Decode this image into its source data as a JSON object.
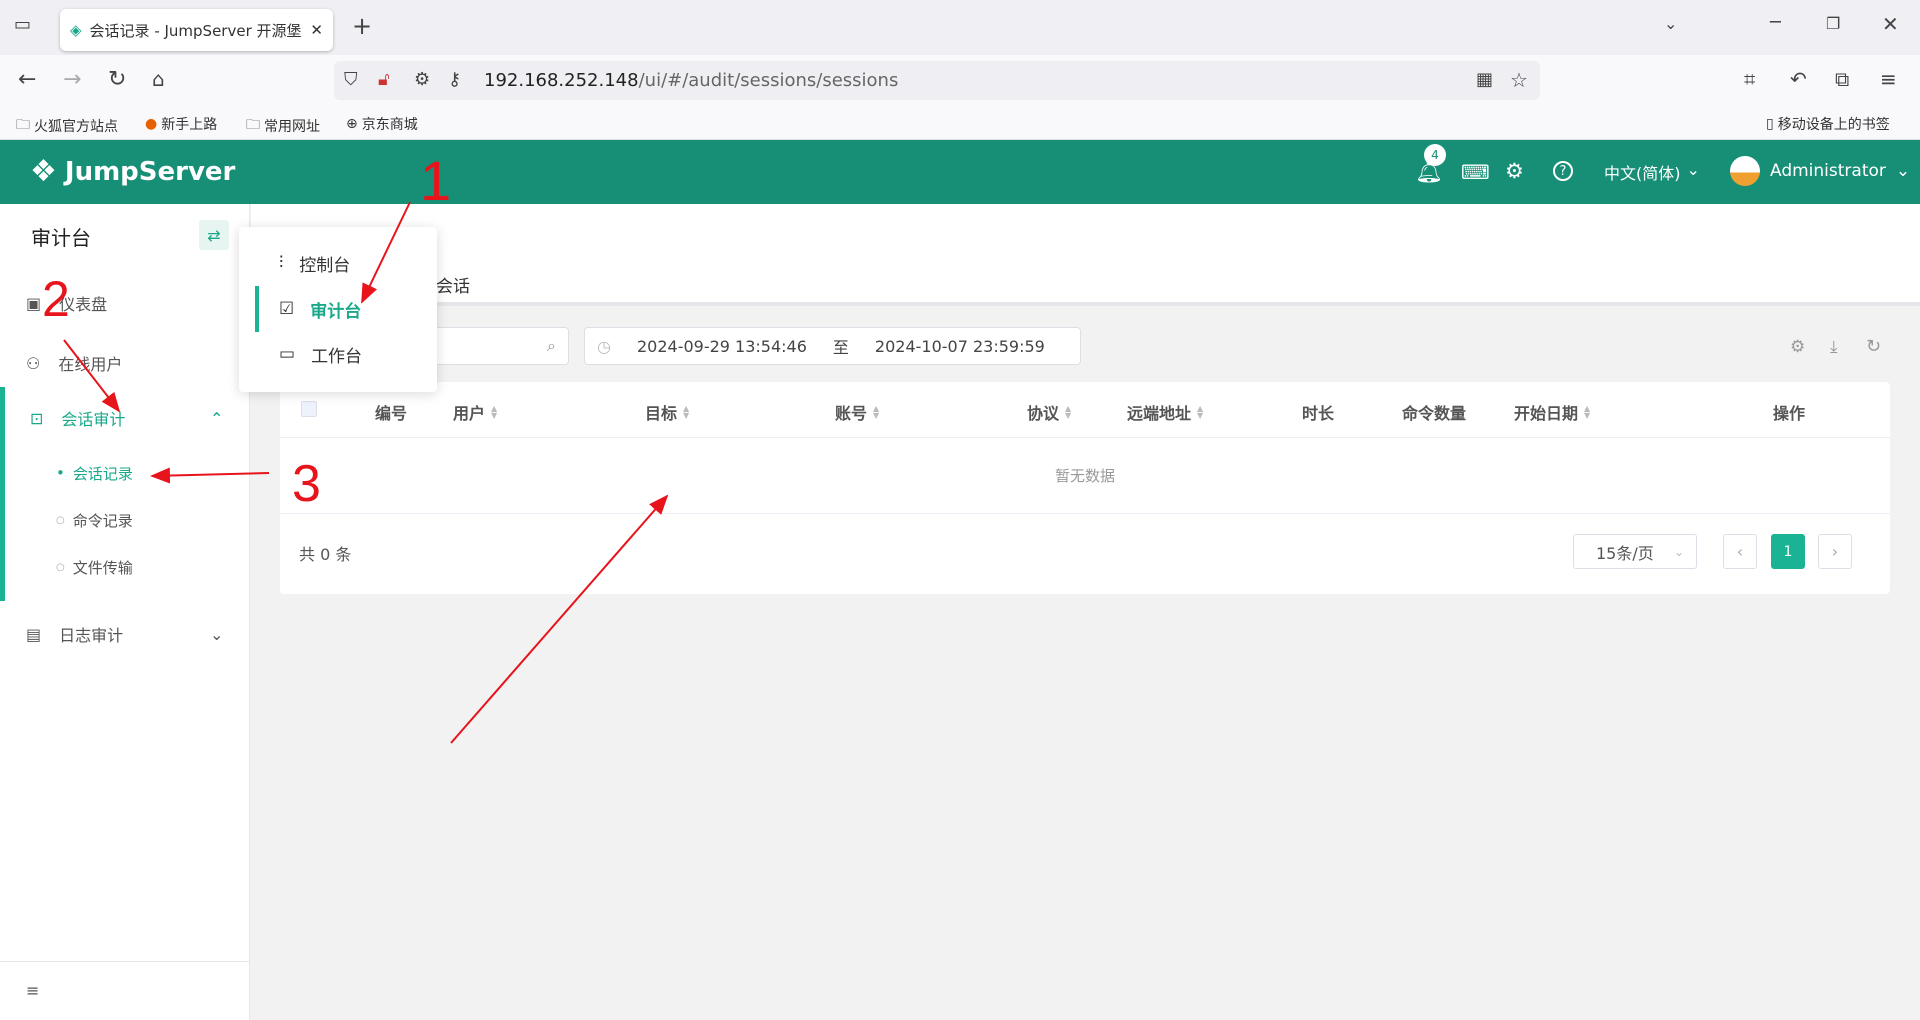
{
  "browser": {
    "tab_title": "会话记录 - JumpServer 开源堡",
    "url_host": "192.168.252.148",
    "url_path": "/ui/#/audit/sessions/sessions",
    "bookmarks": [
      "火狐官方站点",
      "新手上路",
      "常用网址",
      "京东商城"
    ],
    "mobile_bookmarks": "移动设备上的书签"
  },
  "header": {
    "brand": "JumpServer",
    "notification_count": "4",
    "language": "中文(简体)",
    "user": "Administrator",
    "accent": "#178f76"
  },
  "sidebar": {
    "title": "审计台",
    "items": [
      {
        "label": "仪表盘"
      },
      {
        "label": "在线用户"
      },
      {
        "label": "会话审计",
        "expanded": true,
        "children": [
          {
            "label": "会话记录",
            "active": true
          },
          {
            "label": "命令记录"
          },
          {
            "label": "文件传输"
          }
        ]
      },
      {
        "label": "日志审计"
      }
    ]
  },
  "view_switcher": {
    "items": [
      {
        "label": "控制台"
      },
      {
        "label": "审计台",
        "active": true
      },
      {
        "label": "工作台"
      }
    ]
  },
  "page": {
    "tab": "会话"
  },
  "filters": {
    "date_start": "2024-09-29 13:54:46",
    "date_sep": "至",
    "date_end": "2024-10-07 23:59:59"
  },
  "table": {
    "columns": [
      "编号",
      "用户",
      "目标",
      "账号",
      "协议",
      "远端地址",
      "时长",
      "命令数量",
      "开始日期",
      "操作"
    ],
    "empty_text": "暂无数据"
  },
  "pagination": {
    "total": "共 0 条",
    "page_size": "15条/页",
    "current_page": "1"
  },
  "annotations": [
    "1",
    "2",
    "3"
  ]
}
